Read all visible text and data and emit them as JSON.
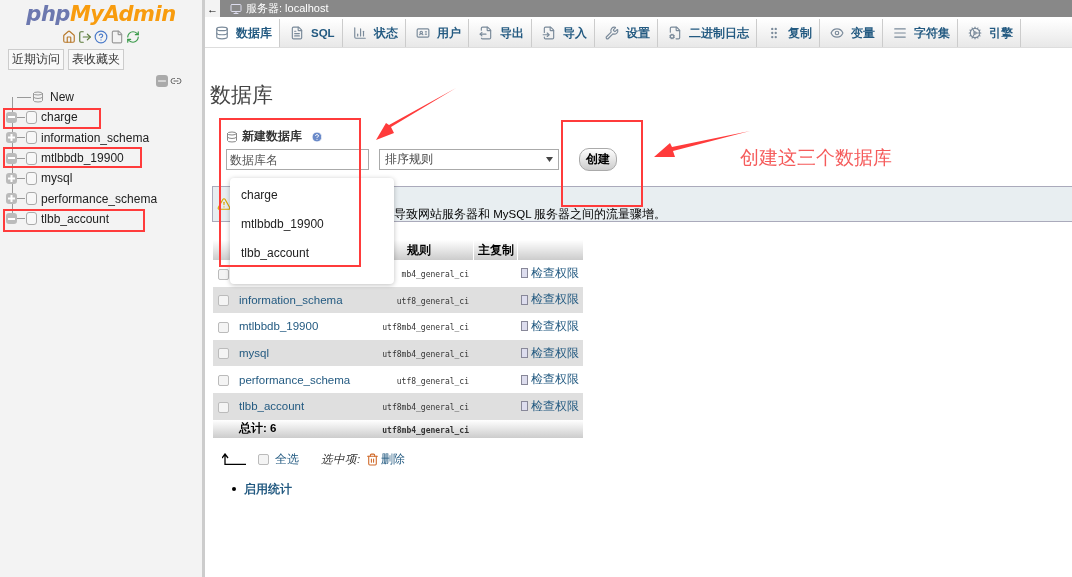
{
  "sidebar": {
    "logo": {
      "php": "php",
      "brand": "MyAdmin"
    },
    "buttons": [
      "近期访问",
      "表收藏夹"
    ],
    "tree": [
      {
        "kind": "new",
        "label": "New"
      },
      {
        "kind": "db",
        "label": "charge",
        "expanded": true
      },
      {
        "kind": "db",
        "label": "information_schema",
        "expanded": false
      },
      {
        "kind": "db",
        "label": "mtlbbdb_19900",
        "expanded": true
      },
      {
        "kind": "db",
        "label": "mysql",
        "expanded": false
      },
      {
        "kind": "db",
        "label": "performance_schema",
        "expanded": false
      },
      {
        "kind": "db",
        "label": "tlbb_account",
        "expanded": true
      }
    ]
  },
  "topbar": {
    "back": "←",
    "title": "服务器: localhost"
  },
  "tabs": [
    {
      "label": "数据库",
      "selected": true
    },
    {
      "label": "SQL",
      "selected": false
    },
    {
      "label": "状态",
      "selected": false
    },
    {
      "label": "用户",
      "selected": false
    },
    {
      "label": "导出",
      "selected": false
    },
    {
      "label": "导入",
      "selected": false
    },
    {
      "label": "设置",
      "selected": false
    },
    {
      "label": "二进制日志",
      "selected": false
    },
    {
      "label": "复制",
      "selected": false
    },
    {
      "label": "变量",
      "selected": false
    },
    {
      "label": "字符集",
      "selected": false
    },
    {
      "label": "引擎",
      "selected": false
    }
  ],
  "heading": "数据库",
  "create": {
    "title": "新建数据库",
    "name_placeholder": "数据库名",
    "collation_placeholder": "排序规则",
    "button": "创建",
    "suggestions": [
      "charge",
      "mtlbbdb_19900",
      "tlbb_account"
    ]
  },
  "notice": "导致网站服务器和 MySQL 服务器之间的流量骤增。",
  "table": {
    "columns": [
      "规则",
      "主复制"
    ],
    "rows": [
      {
        "checked": false,
        "collation": "mb4_general_ci",
        "action": "检查权限"
      },
      {
        "checked": false,
        "name": "information_schema",
        "collation": "utf8_general_ci",
        "action": "检查权限"
      },
      {
        "checked": false,
        "name": "mtlbbdb_19900",
        "collation": "utf8mb4_general_ci",
        "action": "检查权限"
      },
      {
        "checked": false,
        "name": "mysql",
        "collation": "utf8mb4_general_ci",
        "action": "检查权限"
      },
      {
        "checked": false,
        "name": "performance_schema",
        "collation": "utf8_general_ci",
        "action": "检查权限"
      },
      {
        "checked": false,
        "name": "tlbb_account",
        "collation": "utf8mb4_general_ci",
        "action": "检查权限"
      }
    ],
    "total": {
      "label": "总计: 6",
      "collation": "utf8mb4_general_ci"
    }
  },
  "footer": {
    "checked": false,
    "select_all": "全选",
    "with_selected": "选中项:",
    "delete": "删除"
  },
  "links": [
    "启用统计"
  ],
  "annotation": {
    "note": "创建这三个数据库"
  }
}
